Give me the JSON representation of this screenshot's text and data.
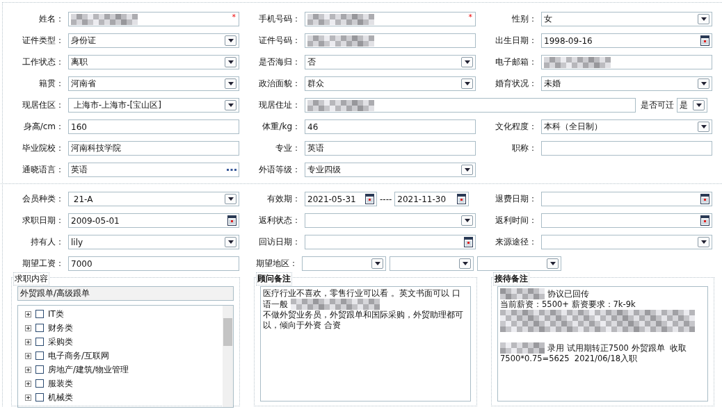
{
  "profile_rows": [
    [
      {
        "label": "姓名：",
        "kind": "text",
        "redacted": true,
        "required_mark": "*"
      },
      {
        "label": "手机号码：",
        "kind": "text",
        "redacted": true,
        "required_mark": "*"
      },
      {
        "label": "性别：",
        "kind": "select",
        "value": "女"
      }
    ],
    [
      {
        "label": "证件类型：",
        "kind": "select",
        "value": "身份证"
      },
      {
        "label": "证件号码：",
        "kind": "text",
        "redacted": true
      },
      {
        "label": "出生日期：",
        "kind": "date",
        "value": "1998-09-16"
      }
    ],
    [
      {
        "label": "工作状态：",
        "kind": "select",
        "value": "离职"
      },
      {
        "label": "是否海归：",
        "kind": "select",
        "value": "否"
      },
      {
        "label": "电子邮箱：",
        "kind": "text",
        "redacted": true
      }
    ],
    [
      {
        "label": "籍贯：",
        "kind": "select",
        "value": "河南省"
      },
      {
        "label": "政治面貌：",
        "kind": "select",
        "value": "群众"
      },
      {
        "label": "婚育状况：",
        "kind": "select",
        "value": "未婚"
      }
    ],
    [
      {
        "label": "现居住区：",
        "kind": "select",
        "value": " 上海市-上海市-[宝山区]"
      },
      {
        "label": "现居住址：",
        "kind": "text",
        "redacted": true,
        "movable": {
          "label": "是否可迁",
          "value": "是"
        }
      }
    ],
    [
      {
        "label": "身高/cm：",
        "kind": "text",
        "value": "160"
      },
      {
        "label": "体重/kg：",
        "kind": "text",
        "value": "46"
      },
      {
        "label": "文化程度：",
        "kind": "select",
        "value": "本科（全日制）"
      }
    ],
    [
      {
        "label": "毕业院校：",
        "kind": "text",
        "value": "河南科技学院"
      },
      {
        "label": "专业：",
        "kind": "text",
        "value": "英语"
      },
      {
        "label": "职称：",
        "kind": "text"
      }
    ],
    [
      {
        "label": "通晓语言：",
        "kind": "lookup",
        "value": "英语"
      },
      {
        "label": "外语等级：",
        "kind": "select",
        "value": "专业四级"
      }
    ]
  ],
  "member_rows": [
    [
      {
        "label": "会员种类：",
        "kind": "select",
        "value": " 21-A"
      },
      {
        "label": "有效期：",
        "kind": "date-range",
        "from": "2021-05-31",
        "separator": "----",
        "to": "2021-11-30"
      },
      {
        "label": "退费日期：",
        "kind": "date"
      }
    ],
    [
      {
        "label": "求职日期：",
        "kind": "date",
        "value": "2009-05-01"
      },
      {
        "label": "返利状态：",
        "kind": "select"
      },
      {
        "label": "返利时间：",
        "kind": "date"
      }
    ],
    [
      {
        "label": "持有人：",
        "kind": "select",
        "value": "lily"
      },
      {
        "label": "回访日期：",
        "kind": "date"
      },
      {
        "label": "来源途径：",
        "kind": "select"
      }
    ],
    [
      {
        "label": "期望工资：",
        "kind": "text",
        "value": "7000"
      },
      {
        "label": "期望地区：",
        "kind": "multi-select",
        "parts": [
          {
            "kind": "select"
          },
          {
            "kind": "select"
          },
          {
            "kind": "select"
          }
        ]
      }
    ]
  ],
  "job_panel": {
    "legend": "求职内容",
    "summary": "外贸跟单/高级跟单",
    "tree": [
      {
        "label": "IT类",
        "expanded": false,
        "checked": false
      },
      {
        "label": "财务类",
        "expanded": false,
        "checked": false
      },
      {
        "label": "采购类",
        "expanded": false,
        "checked": false
      },
      {
        "label": "电子商务/互联网",
        "expanded": false,
        "checked": false
      },
      {
        "label": "房地产/建筑/物业管理",
        "expanded": false,
        "checked": false
      },
      {
        "label": "服装类",
        "expanded": false,
        "checked": false
      },
      {
        "label": "机械类",
        "expanded": false,
        "checked": false
      }
    ]
  },
  "advisor_panel": {
    "legend": "顾问备注",
    "lines": [
      {
        "text": "医疗行业不喜欢，零售行业可以看 。英文书面可以 口"
      },
      {
        "parts": [
          {
            "kind": "text",
            "text": "语一般"
          },
          {
            "kind": "redacted"
          }
        ]
      },
      {
        "text": "不做外贸业务员，外贸跟单和国际采购，外贸助理都可"
      },
      {
        "text": "以，倾向于外资 合资"
      }
    ]
  },
  "reception_panel": {
    "legend": "接待备注",
    "lines": [
      {
        "parts": [
          {
            "kind": "redacted"
          },
          {
            "kind": "text",
            "text": "协议已回传"
          }
        ]
      },
      {
        "text": "当前薪资：5500+ 薪资要求：7k-9k"
      },
      {
        "parts": [
          {
            "kind": "redacted-block"
          }
        ]
      },
      {
        "parts": [
          {
            "kind": "redacted"
          },
          {
            "kind": "text",
            "text": "录用 试用期转正7500 外贸跟单  收取"
          }
        ]
      },
      {
        "text": "7500*0.75=5625  2021/06/18入职"
      }
    ]
  }
}
